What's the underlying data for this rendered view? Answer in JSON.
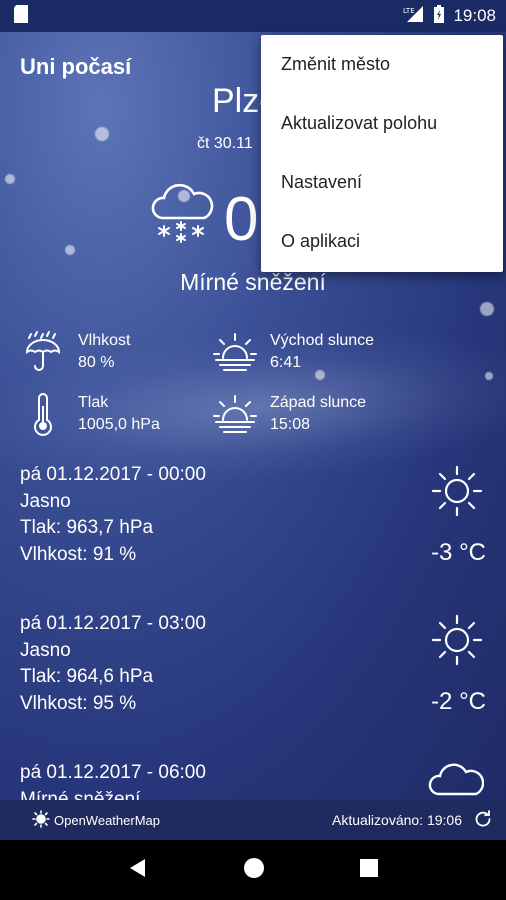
{
  "status": {
    "time": "19:08",
    "network": "LTE"
  },
  "app": {
    "title": "Uni počasí"
  },
  "current": {
    "city": "Plze",
    "date": "čt 30.11",
    "temp": "0",
    "condition": "Mírné sněžení",
    "icon": "snow-cloud-icon"
  },
  "details": [
    {
      "label": "Vlhkost",
      "value": "80 %",
      "icon": "umbrella-rain-icon"
    },
    {
      "label": "Východ slunce",
      "value": "6:41",
      "icon": "sunrise-icon"
    },
    {
      "label": "Tlak",
      "value": "1005,0 hPa",
      "icon": "thermometer-icon"
    },
    {
      "label": "Západ slunce",
      "value": "15:08",
      "icon": "sunset-icon"
    }
  ],
  "forecast": [
    {
      "datetime": "pá 01.12.2017 - 00:00",
      "condition": "Jasno",
      "pressure": "Tlak: 963,7 hPa",
      "humidity": "Vlhkost: 91 %",
      "temp": "-3 °C",
      "icon": "sun-icon"
    },
    {
      "datetime": "pá 01.12.2017 - 03:00",
      "condition": "Jasno",
      "pressure": "Tlak: 964,6 hPa",
      "humidity": "Vlhkost: 95 %",
      "temp": "-2 °C",
      "icon": "sun-icon"
    },
    {
      "datetime": "pá 01.12.2017 - 06:00",
      "condition": "Mírné sněžení",
      "pressure": "",
      "humidity": "",
      "temp": "",
      "icon": "snow-cloud-icon"
    }
  ],
  "footer": {
    "provider": "OpenWeatherMap",
    "updated": "Aktualizováno: 19:06"
  },
  "menu": {
    "items": [
      "Změnit město",
      "Aktualizovat polohu",
      "Nastavení",
      "O aplikaci"
    ]
  },
  "colors": {
    "background": "#27367a",
    "footer": "#1f2a5e",
    "menu": "#ffffff"
  }
}
